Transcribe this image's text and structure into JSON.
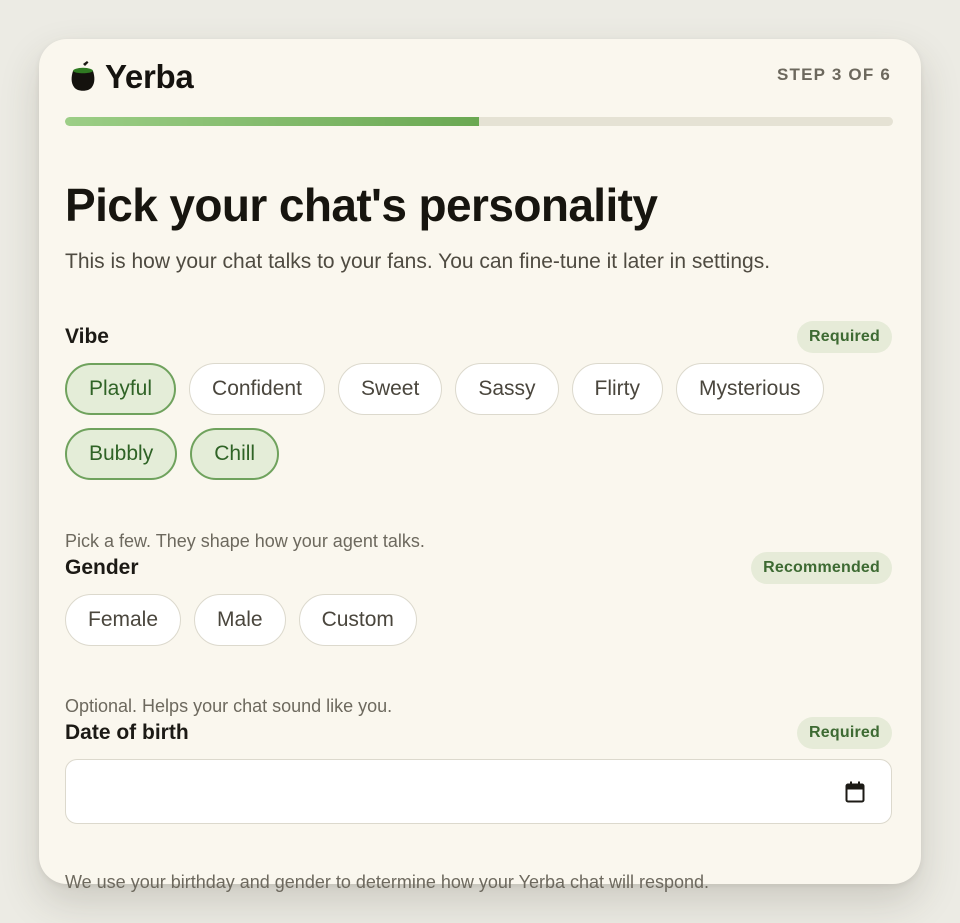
{
  "brand": {
    "name": "Yerba",
    "icon": "mate-gourd-icon"
  },
  "step": {
    "label": "STEP 3 OF 6",
    "current": 3,
    "total": 6
  },
  "progress": {
    "fraction": 0.5
  },
  "page": {
    "title": "Pick your chat's personality",
    "subtitle": "This is how your chat talks to your fans. You can fine-tune it later in settings."
  },
  "vibe": {
    "label": "Vibe",
    "badge": "Required",
    "options": [
      {
        "label": "Playful",
        "selected": true
      },
      {
        "label": "Confident",
        "selected": false
      },
      {
        "label": "Sweet",
        "selected": false
      },
      {
        "label": "Sassy",
        "selected": false
      },
      {
        "label": "Flirty",
        "selected": false
      },
      {
        "label": "Mysterious",
        "selected": false
      },
      {
        "label": "Bubbly",
        "selected": true
      },
      {
        "label": "Chill",
        "selected": true
      }
    ],
    "help": "Pick a few. They shape how your agent talks."
  },
  "gender": {
    "label": "Gender",
    "badge": "Recommended",
    "options": [
      {
        "label": "Female",
        "selected": false
      },
      {
        "label": "Male",
        "selected": false
      },
      {
        "label": "Custom",
        "selected": false
      }
    ],
    "help": "Optional. Helps your chat sound like you."
  },
  "dob": {
    "label": "Date of birth",
    "badge": "Required",
    "value": "",
    "icon": "calendar-icon",
    "help": "We use your birthday and gender to determine how your Yerba chat will respond."
  },
  "colors": {
    "accent": "#6fa25d",
    "background": "#faf7ee",
    "badge_bg": "#e6ebd8"
  }
}
